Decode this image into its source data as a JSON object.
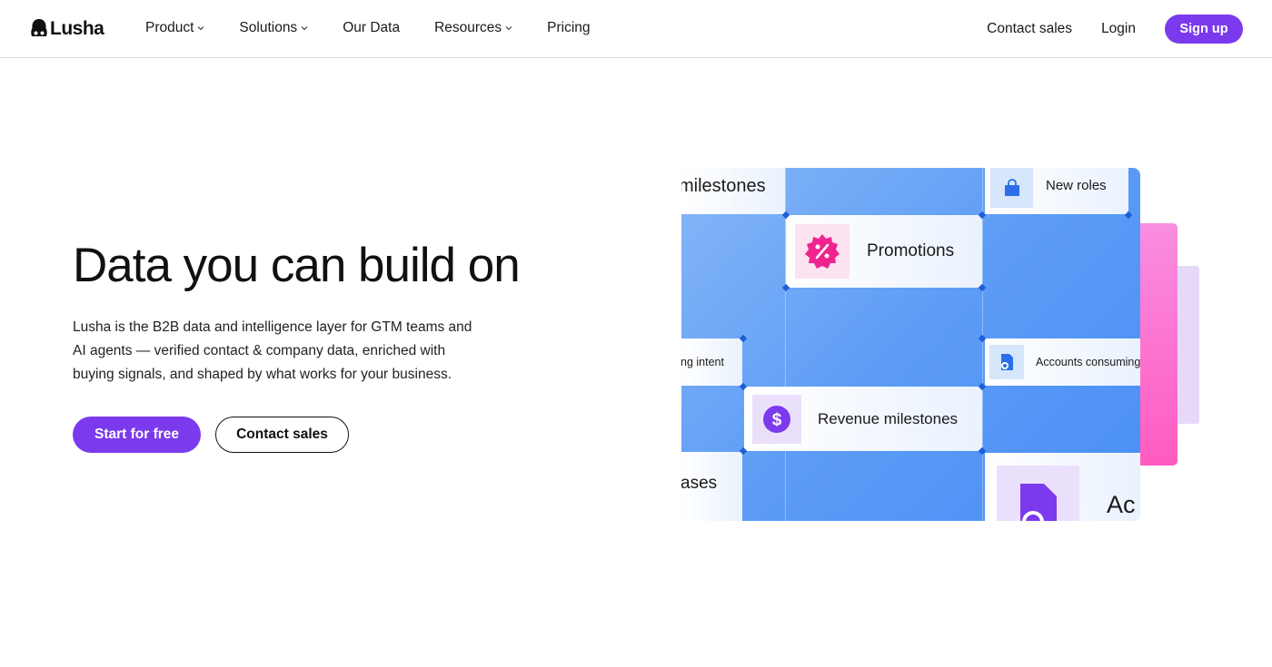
{
  "brand": {
    "name": "Lusha",
    "accent": "#7c3aed"
  },
  "nav": {
    "items": [
      {
        "label": "Product",
        "dropdown": true
      },
      {
        "label": "Solutions",
        "dropdown": true
      },
      {
        "label": "Our Data",
        "dropdown": false
      },
      {
        "label": "Resources",
        "dropdown": true
      },
      {
        "label": "Pricing",
        "dropdown": false
      }
    ],
    "contact_sales": "Contact sales",
    "login": "Login",
    "signup": "Sign up"
  },
  "hero": {
    "title": "Data you can build on",
    "subtitle": "Lusha is the B2B data and intelligence layer for GTM teams and AI agents — verified contact & company data, enriched with buying signals, and shaped by what works for your business.",
    "primary_cta": "Start for free",
    "secondary_cta": "Contact sales"
  },
  "illustration": {
    "cards": {
      "milestones_partial": "milestones",
      "new_roles": "New roles",
      "promotions": "Promotions",
      "intent_partial": "ng intent",
      "accounts_consuming": "Accounts consuming",
      "revenue_milestones": "Revenue milestones",
      "cases_partial": "ases",
      "acc_partial": "Ac"
    },
    "icons": {
      "new_roles": "shopping-bag-icon",
      "promotions": "percent-badge-icon",
      "accounts_consuming": "document-view-icon",
      "revenue_milestones": "dollar-coin-icon",
      "acc": "document-icon"
    }
  }
}
